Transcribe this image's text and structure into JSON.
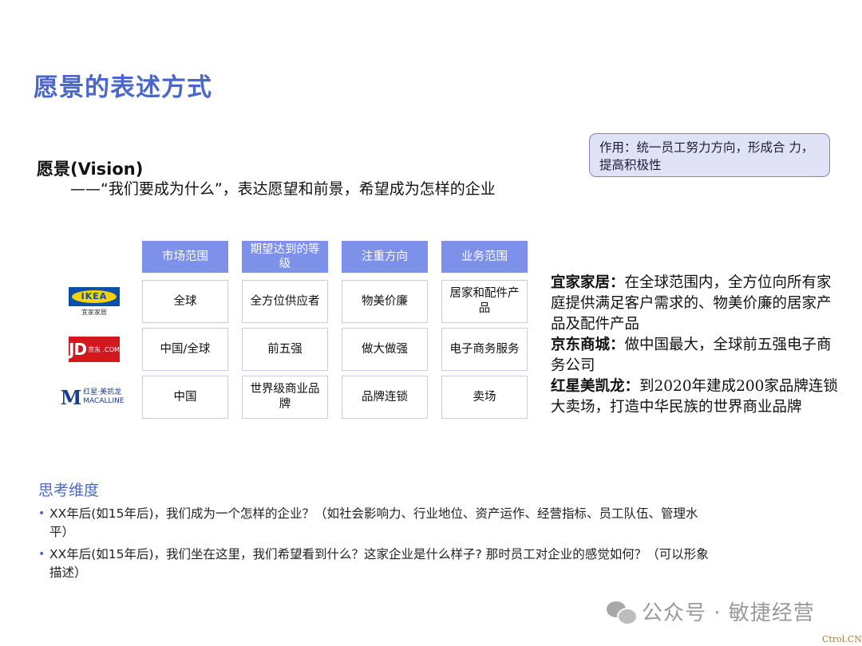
{
  "title": "愿景的表述方式",
  "callout": "作用：统一员工努力方向，形成合 力，提高积极性",
  "vision": {
    "heading": "愿景(Vision)",
    "description": "——“我们要成为什么”，表达愿望和前景，希望成为怎样的企业"
  },
  "table": {
    "headers": [
      "市场范围",
      "期望达到的等级",
      "注重方向",
      "业务范围"
    ],
    "rows": [
      {
        "logo": "ikea-logo",
        "logo_text": "IKEA",
        "logo_sub": "宜家家居",
        "cells": [
          "全球",
          "全方位供应者",
          "物美价廉",
          "居家和配件产品"
        ]
      },
      {
        "logo": "jd-logo",
        "logo_text": "JD",
        "logo_sub": "京东 .COM",
        "cells": [
          "中国/全球",
          "前五强",
          "做大做强",
          "电子商务服务"
        ]
      },
      {
        "logo": "macalline-logo",
        "logo_text": "M",
        "logo_sub": "红星·美凯龙 MACALLINE",
        "cells": [
          "中国",
          "世界级商业品牌",
          "品牌连锁",
          "卖场"
        ]
      }
    ]
  },
  "companies": [
    {
      "name": "宜家家居：",
      "text": "在全球范围内，全方位向所有家庭提供满足客户需求的、物美价廉的居家产品及配件产品"
    },
    {
      "name": "京东商城：",
      "text": "做中国最大，全球前五强电子商务公司"
    },
    {
      "name": "红星美凯龙：",
      "text": "到2020年建成200家品牌连锁大卖场，打造中华民族的世界商业品牌"
    }
  ],
  "thinking": {
    "title": "思考维度",
    "bullets": [
      "XX年后(如15年后)，我们成为一个怎样的企业？（如社会影响力、行业地位、资产运作、经营指标、员工队伍、管理水平）",
      "XX年后(如15年后)，我们坐在这里，我们希望看到什么？这家企业是什么样子? 那时员工对企业的感觉如何？（可以形象描述）"
    ],
    "bullet_marker": "•"
  },
  "watermark": "公众号 · 敏捷经营",
  "corner_mark": "Ctrol.CN",
  "colors": {
    "accent": "#4a67c9",
    "header_bg": "#7d90ea",
    "callout_bg": "#dfe3f5"
  }
}
